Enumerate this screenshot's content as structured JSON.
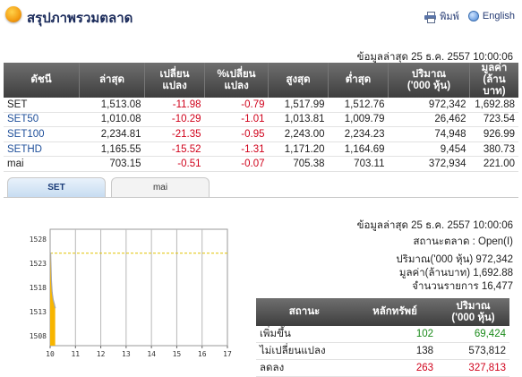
{
  "header": {
    "title": "สรุปภาพรวมตลาด",
    "print_label": "พิมพ์",
    "english_label": "English"
  },
  "updated_top": "ข้อมูลล่าสุด 25 ธ.ค. 2557 10:00:06",
  "market_table": {
    "headers": [
      {
        "l1": "ดัชนี",
        "l2": ""
      },
      {
        "l1": "ล่าสุด",
        "l2": ""
      },
      {
        "l1": "เปลี่ยน",
        "l2": "แปลง"
      },
      {
        "l1": "%เปลี่ยน",
        "l2": "แปลง"
      },
      {
        "l1": "สูงสุด",
        "l2": ""
      },
      {
        "l1": "ต่ำสุด",
        "l2": ""
      },
      {
        "l1": "ปริมาณ",
        "l2": "('000 หุ้น)"
      },
      {
        "l1": "มูลค่า",
        "l2": "(ล้านบาท)"
      }
    ],
    "rows": [
      {
        "index": "SET",
        "last": "1,513.08",
        "change": "-11.98",
        "pct": "-0.79",
        "high": "1,517.99",
        "low": "1,512.76",
        "volume": "972,342",
        "value": "1,692.88"
      },
      {
        "index": "SET50",
        "last": "1,010.08",
        "change": "-10.29",
        "pct": "-1.01",
        "high": "1,013.81",
        "low": "1,009.79",
        "volume": "26,462",
        "value": "723.54"
      },
      {
        "index": "SET100",
        "last": "2,234.81",
        "change": "-21.35",
        "pct": "-0.95",
        "high": "2,243.00",
        "low": "2,234.23",
        "volume": "74,948",
        "value": "926.99"
      },
      {
        "index": "SETHD",
        "last": "1,165.55",
        "change": "-15.52",
        "pct": "-1.31",
        "high": "1,171.20",
        "low": "1,164.69",
        "volume": "9,454",
        "value": "380.73"
      },
      {
        "index": "mai",
        "last": "703.15",
        "change": "-0.51",
        "pct": "-0.07",
        "high": "705.38",
        "low": "703.11",
        "volume": "372,934",
        "value": "221.00"
      }
    ]
  },
  "tabs": [
    {
      "label": "SET",
      "active": true
    },
    {
      "label": "mai",
      "active": false
    }
  ],
  "chart_data": {
    "type": "area",
    "x_ticks": [
      "10",
      "11",
      "12",
      "13",
      "14",
      "15",
      "16",
      "17"
    ],
    "y_ticks": [
      "1528",
      "1523",
      "1518",
      "1513",
      "1508"
    ],
    "ylim": [
      1506,
      1530
    ],
    "xlim": [
      10,
      17
    ],
    "reference_value": 1525.06,
    "series": [
      {
        "x": 10.0,
        "y": 1525.06
      },
      {
        "x": 10.02,
        "y": 1525.06
      },
      {
        "x": 10.05,
        "y": 1519.5
      },
      {
        "x": 10.08,
        "y": 1517.0
      },
      {
        "x": 10.12,
        "y": 1515.5
      },
      {
        "x": 10.17,
        "y": 1514.5
      },
      {
        "x": 10.2,
        "y": 1513.8
      }
    ],
    "colors": {
      "fill": "#f7b500",
      "line": "#a8a8a8",
      "reference": "#e0c200"
    }
  },
  "info": {
    "updated": "ข้อมูลล่าสุด 25 ธ.ค. 2557 10:00:06",
    "status": "สถานะตลาด : Open(I)",
    "volume": "ปริมาณ('000 หุ้น) 972,342",
    "value": "มูลค่า(ล้านบาท) 1,692.88",
    "trades": "จำนวนรายการ 16,477"
  },
  "stat_table": {
    "headers": [
      {
        "l1": "สถานะ",
        "l2": ""
      },
      {
        "l1": "หลักทรัพย์",
        "l2": ""
      },
      {
        "l1": "ปริมาณ",
        "l2": "('000 หุ้น)"
      }
    ],
    "rows": [
      {
        "label": "เพิ่มขึ้น",
        "count": "102",
        "volume": "69,424",
        "tone": "pos"
      },
      {
        "label": "ไม่เปลี่ยนแปลง",
        "count": "138",
        "volume": "573,812",
        "tone": ""
      },
      {
        "label": "ลดลง",
        "count": "263",
        "volume": "327,813",
        "tone": "neg"
      }
    ]
  }
}
